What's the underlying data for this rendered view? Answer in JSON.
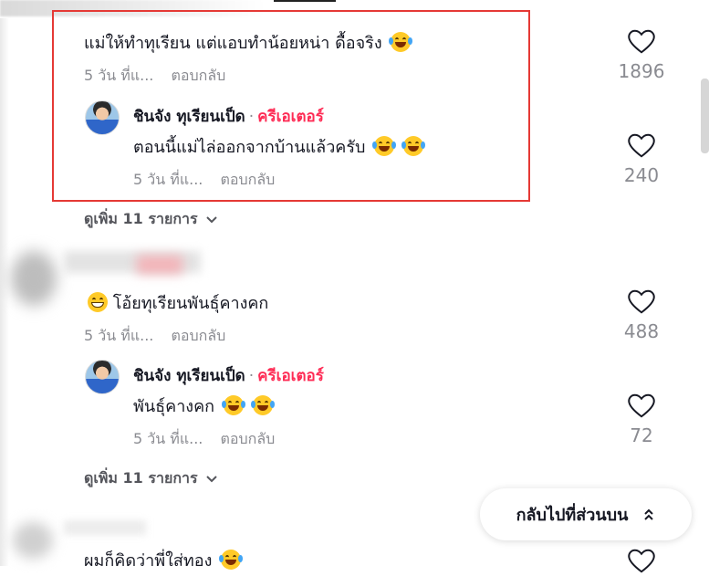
{
  "comments": [
    {
      "text": "แม่ให้ทำทุเรียน แต่แอบทำน้อยหน่า ดื้อจริง",
      "time": "5 วัน ที่แ...",
      "reply_label": "ตอบกลับ",
      "likes": "1896",
      "reply": {
        "username": "ชินจัง ทุเรียนเป็ด",
        "separator": "·",
        "badge": "ครีเอเตอร์",
        "text": "ตอนนี้แม่ไล่ออกจากบ้านแล้วครับ",
        "time": "5 วัน ที่แ...",
        "reply_label": "ตอบกลับ",
        "likes": "240"
      },
      "see_more": "ดูเพิ่ม 11 รายการ"
    },
    {
      "text": "โอ้ยทุเรียนพันธุ์คางคก",
      "time": "5 วัน ที่แ...",
      "reply_label": "ตอบกลับ",
      "likes": "488",
      "reply": {
        "username": "ชินจัง ทุเรียนเป็ด",
        "separator": "·",
        "badge": "ครีเอเตอร์",
        "text": "พันธุ์คางคก",
        "time": "5 วัน ที่แ...",
        "reply_label": "ตอบกลับ",
        "likes": "72"
      },
      "see_more": "ดูเพิ่ม 11 รายการ"
    },
    {
      "text": "ผมก็คิดว่าพี่ใส่ทอง"
    }
  ],
  "back_to_top": "กลับไปที่ส่วนบน",
  "icons": {
    "like": "heart-outline-icon",
    "expand": "chevron-down-icon",
    "back_to_top": "double-chevron-up-icon",
    "emoji_laugh": "face-with-tears-of-joy",
    "emoji_grin": "grinning-face"
  },
  "colors": {
    "creator_badge": "#fe2c55",
    "highlight": "#e53935",
    "muted": "#8a8b91"
  }
}
